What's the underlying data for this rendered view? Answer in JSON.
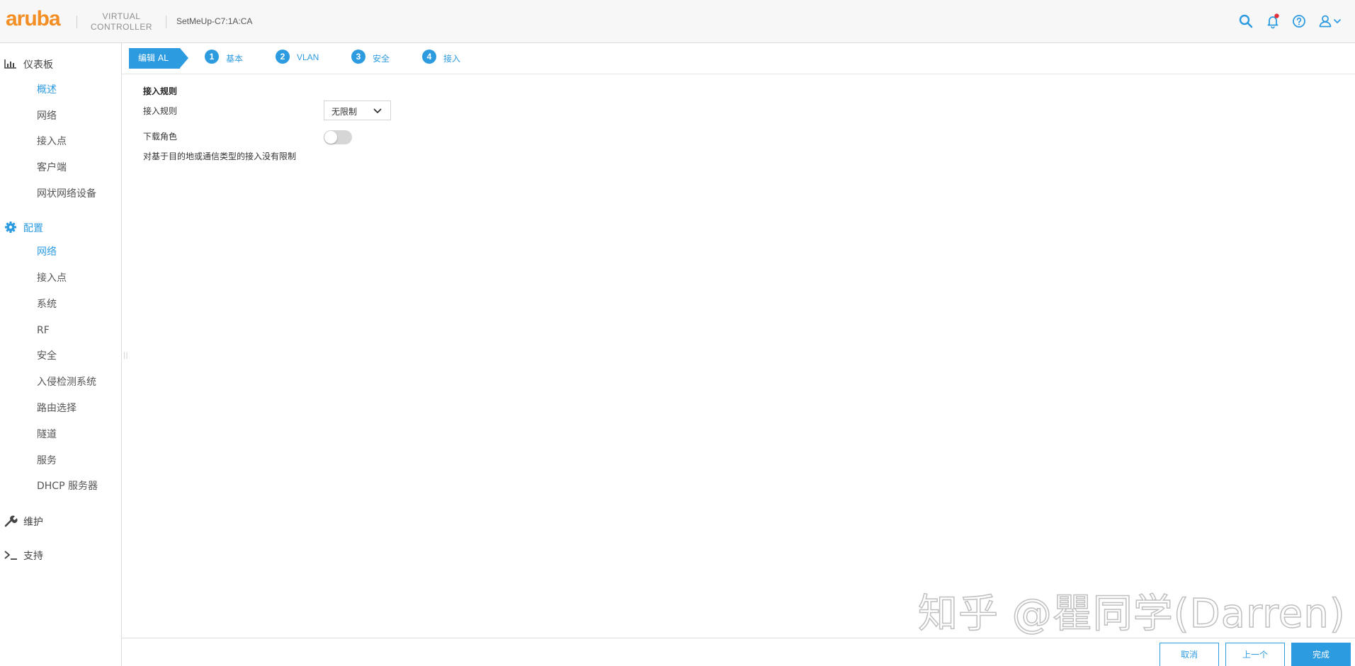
{
  "header": {
    "logo": "aruba",
    "product_line1": "VIRTUAL",
    "product_line2": "CONTROLLER",
    "device_name": "SetMeUp-C7:1A:CA",
    "icons": [
      "search-icon",
      "bell-icon",
      "help-icon",
      "user-icon"
    ]
  },
  "sidebar": {
    "dashboard": {
      "label": "仪表板",
      "items": [
        "概述",
        "网络",
        "接入点",
        "客户端",
        "网状网络设备"
      ],
      "active_item": "概述"
    },
    "config": {
      "label": "配置",
      "items": [
        "网络",
        "接入点",
        "系统",
        "RF",
        "安全",
        "入侵检测系统",
        "路由选择",
        "隧道",
        "服务",
        "DHCP 服务器"
      ],
      "active_item": "网络"
    },
    "maintenance": {
      "label": "维护"
    },
    "support": {
      "label": "支持"
    }
  },
  "wizard": {
    "crumb": "编辑 AL",
    "steps": [
      {
        "num": "1",
        "label": "基本"
      },
      {
        "num": "2",
        "label": "VLAN"
      },
      {
        "num": "3",
        "label": "安全"
      },
      {
        "num": "4",
        "label": "接入"
      }
    ]
  },
  "form": {
    "section_title": "接入规则",
    "rule_label": "接入规则",
    "rule_value": "无限制",
    "download_role_label": "下载角色",
    "download_role_on": false,
    "description": "对基于目的地或通信类型的接入没有限制"
  },
  "watermark": "知乎 @瞿同学(Darren)",
  "footer": {
    "cancel": "取消",
    "prev": "上一个",
    "finish": "完成"
  },
  "colors": {
    "accent": "#2d9be0",
    "brand": "#f28e23"
  }
}
